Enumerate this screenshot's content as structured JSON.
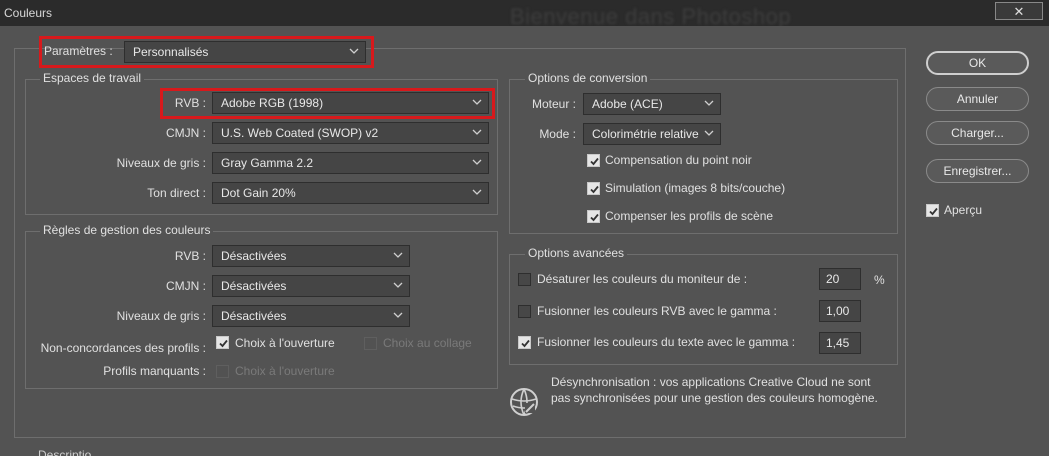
{
  "window": {
    "title": "Couleurs",
    "background_title": "Bienvenue dans Photoshop",
    "close_glyph": "✕"
  },
  "settings": {
    "label": "Paramètres :",
    "value": "Personnalisés"
  },
  "working_spaces": {
    "title": "Espaces de travail",
    "rgb": {
      "label": "RVB :",
      "value": "Adobe RGB (1998)"
    },
    "cmyk": {
      "label": "CMJN :",
      "value": "U.S. Web Coated (SWOP) v2"
    },
    "gray": {
      "label": "Niveaux de gris :",
      "value": "Gray Gamma 2.2"
    },
    "spot": {
      "label": "Ton direct :",
      "value": "Dot Gain 20%"
    }
  },
  "policies": {
    "title": "Règles de gestion des couleurs",
    "rgb": {
      "label": "RVB :",
      "value": "Désactivées"
    },
    "cmyk": {
      "label": "CMJN :",
      "value": "Désactivées"
    },
    "gray": {
      "label": "Niveaux de gris :",
      "value": "Désactivées"
    },
    "mismatch_label": "Non-concordances des profils :",
    "ask_open": "Choix à l'ouverture",
    "ask_paste": "Choix au collage",
    "missing_label": "Profils manquants :",
    "missing_ask_open": "Choix à l'ouverture"
  },
  "conversion": {
    "title": "Options de conversion",
    "engine": {
      "label": "Moteur :",
      "value": "Adobe (ACE)"
    },
    "intent": {
      "label": "Mode :",
      "value": "Colorimétrie relative"
    },
    "black_point": "Compensation du point noir",
    "dither": "Simulation (images 8 bits/couche)",
    "scene_profiles": "Compenser les profils de scène"
  },
  "advanced": {
    "title": "Options avancées",
    "desaturate": {
      "label": "Désaturer les couleurs du moniteur de :",
      "value": "20",
      "unit": "%"
    },
    "blend_rgb": {
      "label": "Fusionner les couleurs RVB avec le gamma :",
      "value": "1,00"
    },
    "blend_text": {
      "label": "Fusionner les couleurs du texte avec le gamma :",
      "value": "1,45"
    }
  },
  "sync": {
    "line1": "Désynchronisation : vos applications Creative Cloud ne sont",
    "line2": "pas synchronisées pour une gestion des couleurs homogène."
  },
  "buttons": {
    "ok": "OK",
    "cancel": "Annuler",
    "load": "Charger...",
    "save": "Enregistrer..."
  },
  "preview": {
    "label": "Aperçu"
  },
  "footer_cut": "Descriptio",
  "colors": {
    "highlight": "#d7191c",
    "dialog_bg": "#535353",
    "titlebar_bg": "#2b2b2b"
  }
}
